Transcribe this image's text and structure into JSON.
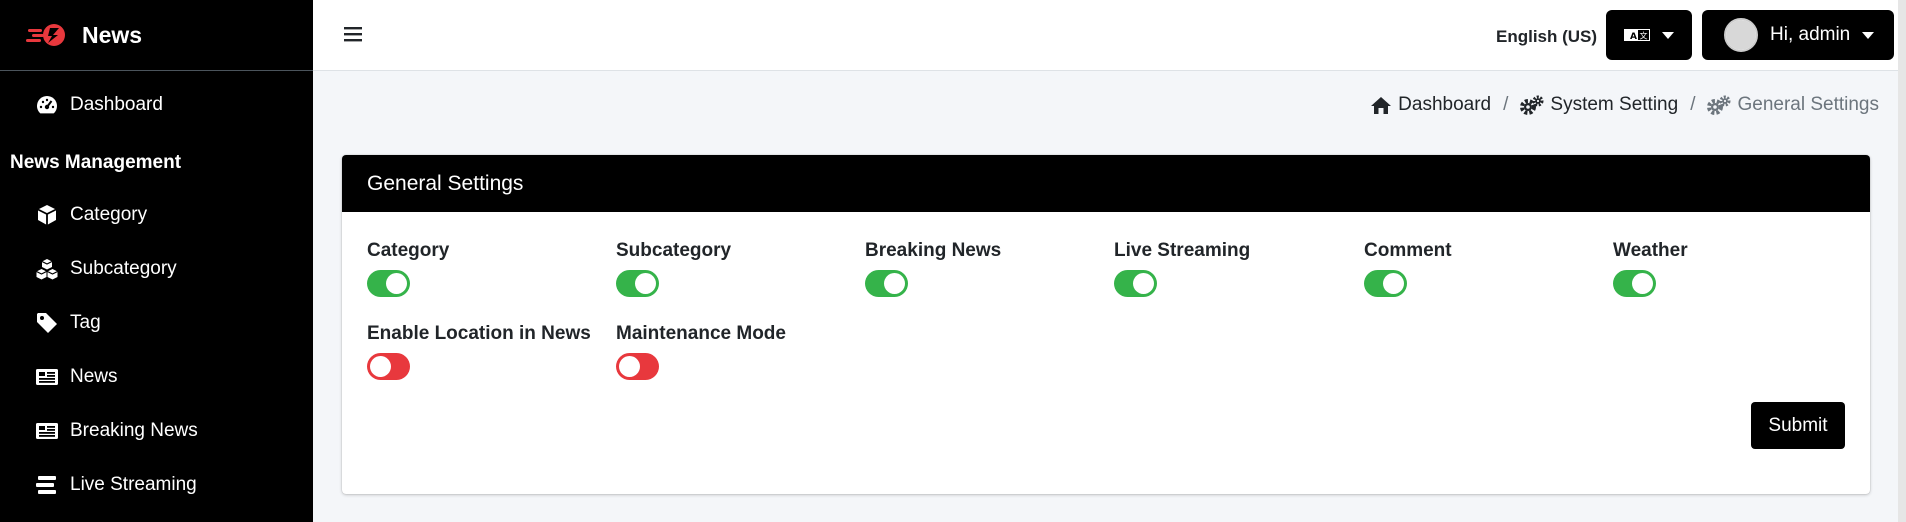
{
  "brand": {
    "title": "News",
    "logo_icon": "news-logo-icon",
    "accent": "#e8383d"
  },
  "sidebar": {
    "items_top": [
      {
        "label": "Dashboard",
        "icon": "gauge-icon"
      }
    ],
    "section_header": "News Management",
    "items": [
      {
        "label": "Category",
        "icon": "cube-icon"
      },
      {
        "label": "Subcategory",
        "icon": "cubes-icon"
      },
      {
        "label": "Tag",
        "icon": "tag-icon"
      },
      {
        "label": "News",
        "icon": "newspaper-icon"
      },
      {
        "label": "Breaking News",
        "icon": "newspaper-icon"
      },
      {
        "label": "Live Streaming",
        "icon": "stream-icon"
      }
    ]
  },
  "topbar": {
    "menu_icon": "hamburger-icon",
    "language_label": "English (US)",
    "language_icon": "translate-icon",
    "user_greeting": "Hi, admin"
  },
  "breadcrumb": [
    {
      "label": "Dashboard",
      "icon": "home-icon"
    },
    {
      "label": "System Setting",
      "icon": "gears-icon"
    },
    {
      "label": "General Settings",
      "icon": "gears-icon"
    }
  ],
  "card": {
    "title": "General Settings",
    "settings": [
      {
        "label": "Category",
        "enabled": true
      },
      {
        "label": "Subcategory",
        "enabled": true
      },
      {
        "label": "Breaking News",
        "enabled": true
      },
      {
        "label": "Live Streaming",
        "enabled": true
      },
      {
        "label": "Comment",
        "enabled": true
      },
      {
        "label": "Weather",
        "enabled": true
      },
      {
        "label": "Enable Location in News",
        "enabled": false
      },
      {
        "label": "Maintenance Mode",
        "enabled": false
      }
    ],
    "submit_label": "Submit"
  },
  "colors": {
    "toggle_on": "#35b34a",
    "toggle_off": "#e8383d",
    "sidebar_bg": "#000000"
  }
}
